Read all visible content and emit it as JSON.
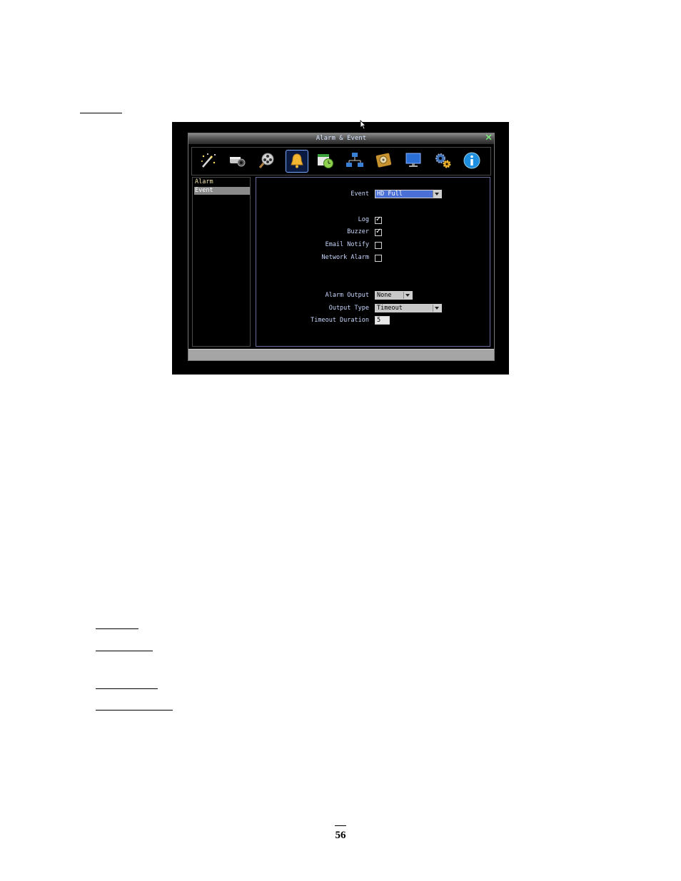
{
  "window": {
    "title": "Alarm & Event",
    "close_icon": "close-x-icon"
  },
  "toolbar": {
    "icons": [
      "quick-setup-wand-icon",
      "camera-icon",
      "search-film-icon",
      "alarm-bell-icon",
      "schedule-icon",
      "network-icon",
      "storage-disk-icon",
      "display-monitor-icon",
      "system-gears-icon",
      "info-icon"
    ],
    "selected": "alarm-bell-icon"
  },
  "sidebar": {
    "items": [
      {
        "label": "Alarm"
      },
      {
        "label": "Event"
      }
    ],
    "selected": "Event"
  },
  "form": {
    "event": {
      "label": "Event",
      "value": "HD Full"
    },
    "log": {
      "label": "Log",
      "checked": true
    },
    "buzzer": {
      "label": "Buzzer",
      "checked": true
    },
    "email_notify": {
      "label": "Email Notify",
      "checked": false
    },
    "network_alarm": {
      "label": "Network Alarm",
      "checked": false
    },
    "alarm_output": {
      "label": "Alarm Output",
      "value": "None"
    },
    "output_type": {
      "label": "Output Type",
      "value": "Timeout"
    },
    "timeout_duration": {
      "label": "Timeout Duration",
      "value": "5"
    }
  },
  "page": {
    "number": "56"
  },
  "colors": {
    "selection_blue": "#4a6fd6",
    "label_blue": "#c9d8ff",
    "menu_text": "#f4e4a8",
    "close_green": "#7fff7f"
  }
}
